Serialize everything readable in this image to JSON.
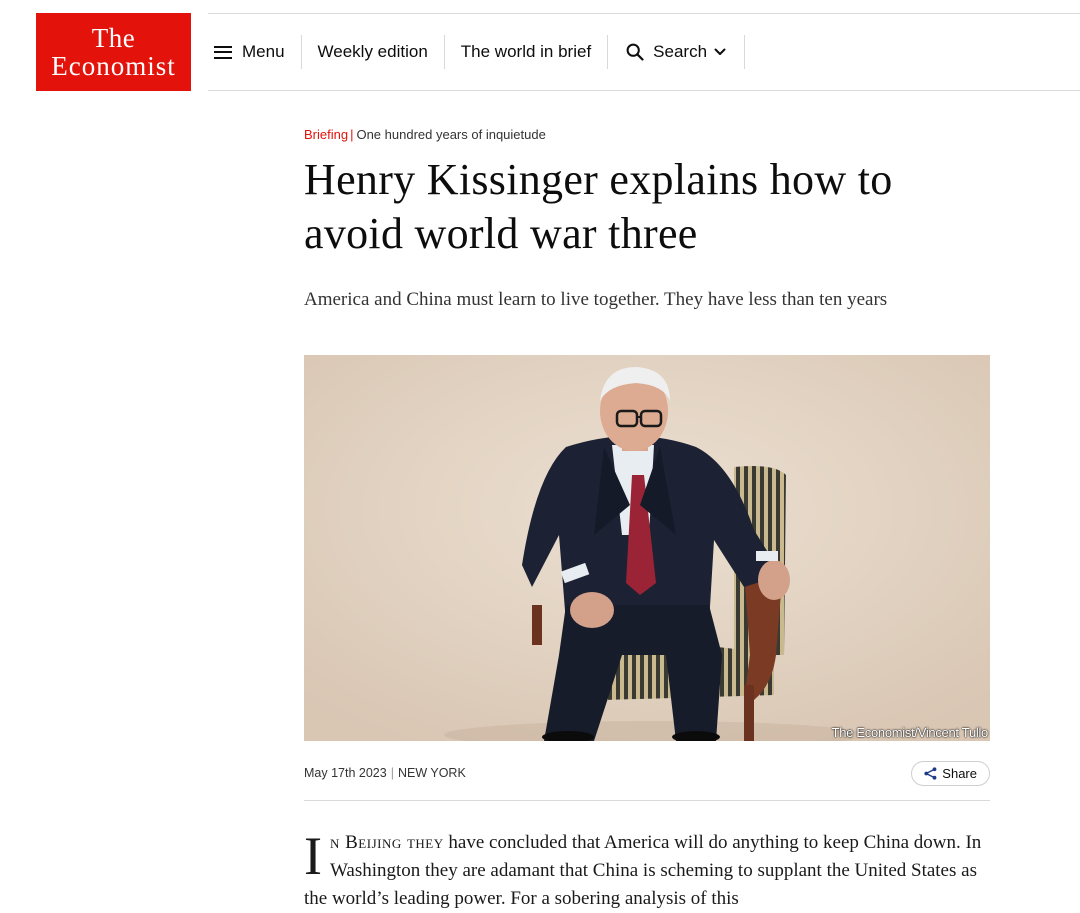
{
  "header": {
    "logo_line1": "The",
    "logo_line2": "Economist",
    "nav": {
      "menu_label": "Menu",
      "weekly_label": "Weekly edition",
      "brief_label": "The world in brief",
      "search_label": "Search"
    }
  },
  "article": {
    "section": "Briefing",
    "rubric": "One hundred years of inquietude",
    "headline": "Henry Kissinger explains how to avoid world war three",
    "standfirst": "America and China must learn to live together. They have less than ten years",
    "image_credit": "The Economist/Vincent Tullo",
    "date": "May 17th 2023",
    "location": "NEW YORK",
    "share_label": "Share",
    "body_dropcap": "I",
    "body_smallcaps": "n Beijing they",
    "body_text": " have concluded that America will do anything to keep China down. In Washington they are adamant that China is scheming to supplant the United States as the world’s leading power. For a sobering analysis of this"
  },
  "colors": {
    "brand_red": "#e3120b",
    "background": "#ffffff",
    "photo_backdrop": "#e6d7c6"
  }
}
